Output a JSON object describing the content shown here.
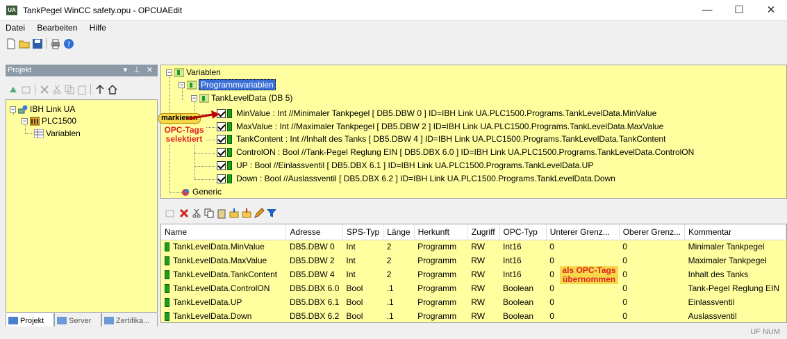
{
  "window": {
    "title": "TankPegel WinCC safety.opu - OPCUAEdit",
    "app_icon_text": "UA"
  },
  "menu": [
    "Datei",
    "Bearbeiten",
    "Hilfe"
  ],
  "left_panel": {
    "header": "Projekt",
    "pin_controls": "▾ ⊥ ✕",
    "tree": {
      "root": "IBH Link UA",
      "plc": "PLC1500",
      "variables": "Variablen"
    },
    "tabs": [
      "Projekt",
      "Server",
      "Zertifika..."
    ]
  },
  "var_tree": {
    "root": "Variablen",
    "program_vars": "Programmvariablen",
    "db": "TankLevelData (DB 5)",
    "items": [
      "MinValue : Int //Minimaler Tankpegel    [ DB5.DBW 0 ]  ID=IBH Link UA.PLC1500.Programs.TankLevelData.MinValue",
      "MaxValue : Int //Maximaler Tankpegel    [ DB5.DBW 2 ]  ID=IBH Link UA.PLC1500.Programs.TankLevelData.MaxValue",
      "TankContent : Int //Inhalt des Tanks    [ DB5.DBW 4 ]  ID=IBH Link UA.PLC1500.Programs.TankLevelData.TankContent",
      "ControlON : Bool //Tank-Pegel Reglung EIN    [ DB5.DBX 6.0 ]  ID=IBH Link UA.PLC1500.Programs.TankLevelData.ControlON",
      "UP : Bool //Einlassventil    [ DB5.DBX 6.1 ]  ID=IBH Link UA.PLC1500.Programs.TankLevelData.UP",
      "Down : Bool //Auslassventil    [ DB5.DBX 6.2 ]  ID=IBH Link UA.PLC1500.Programs.TankLevelData.Down"
    ],
    "generic": "Generic"
  },
  "callouts": {
    "markieren": "markieren",
    "opc_tags_l1": "OPC-Tags",
    "opc_tags_l2": "selektiert",
    "als_l1": "als OPC-Tags",
    "als_l2": "übernommen"
  },
  "table": {
    "headers": [
      "Name",
      "Adresse",
      "SPS-Typ",
      "Länge",
      "Herkunft",
      "Zugriff",
      "OPC-Typ",
      "Unterer Grenz...",
      "Oberer Grenz...",
      "Kommentar"
    ],
    "rows": [
      [
        "TankLevelData.MinValue",
        "DB5.DBW 0",
        "Int",
        "2",
        "Programm",
        "RW",
        "Int16",
        "0",
        "0",
        "Minimaler Tankpegel"
      ],
      [
        "TankLevelData.MaxValue",
        "DB5.DBW 2",
        "Int",
        "2",
        "Programm",
        "RW",
        "Int16",
        "0",
        "0",
        "Maximaler Tankpegel"
      ],
      [
        "TankLevelData.TankContent",
        "DB5.DBW 4",
        "Int",
        "2",
        "Programm",
        "RW",
        "Int16",
        "0",
        "0",
        "Inhalt des Tanks"
      ],
      [
        "TankLevelData.ControlON",
        "DB5.DBX 6.0",
        "Bool",
        ".1",
        "Programm",
        "RW",
        "Boolean",
        "0",
        "0",
        "Tank-Pegel Reglung EIN"
      ],
      [
        "TankLevelData.UP",
        "DB5.DBX 6.1",
        "Bool",
        ".1",
        "Programm",
        "RW",
        "Boolean",
        "0",
        "0",
        "Einlassventil"
      ],
      [
        "TankLevelData.Down",
        "DB5.DBX 6.2",
        "Bool",
        ".1",
        "Programm",
        "RW",
        "Boolean",
        "0",
        "0",
        "Auslassventil"
      ]
    ]
  },
  "status": "UF NUM"
}
